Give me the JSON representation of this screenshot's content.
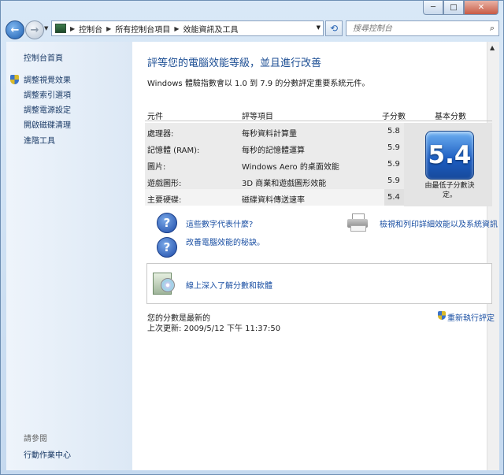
{
  "window": {
    "minimize": "─",
    "maximize": "□",
    "close": "✕"
  },
  "address": {
    "crumbs": [
      "控制台",
      "所有控制台項目",
      "效能資訊及工具"
    ],
    "search_placeholder": "搜尋控制台"
  },
  "sidebar": {
    "home": "控制台首頁",
    "items": [
      "調整視覺效果",
      "調整索引選項",
      "調整電源設定",
      "開啟磁碟清理",
      "進階工具"
    ],
    "see_also_title": "請參閱",
    "see_also_items": [
      "行動作業中心"
    ]
  },
  "main": {
    "title": "評等您的電腦效能等級，並且進行改善",
    "subtitle": "Windows 體驗指數會以 1.0 到 7.9 的分數評定重要系統元件。",
    "table": {
      "headers": [
        "元件",
        "評等項目",
        "子分數",
        "基本分數"
      ],
      "rows": [
        {
          "component": "處理器:",
          "rating": "每秒資料計算量",
          "score": "5.8"
        },
        {
          "component": "記憶體 (RAM):",
          "rating": "每秒的記憶體運算",
          "score": "5.9"
        },
        {
          "component": "圖片:",
          "rating": "Windows Aero 的桌面效能",
          "score": "5.9"
        },
        {
          "component": "遊戲圖形:",
          "rating": "3D 商業和遊戲圖形效能",
          "score": "5.9"
        },
        {
          "component": "主要硬碟:",
          "rating": "磁碟資料傳送速率",
          "score": "5.4"
        }
      ],
      "base_score": "5.4",
      "base_caption": "由最低子分數決定。"
    },
    "links": {
      "what_mean": "這些數字代表什麼?",
      "tips": "改善電腦效能的秘訣。",
      "print": "檢視和列印詳細效能以及系統資訊",
      "online": "線上深入了解分數和軟體"
    },
    "status": {
      "current": "您的分數是最新的",
      "last_update": "上次更新: 2009/5/12 下午 11:37:50",
      "rerun": "重新執行評定"
    }
  }
}
